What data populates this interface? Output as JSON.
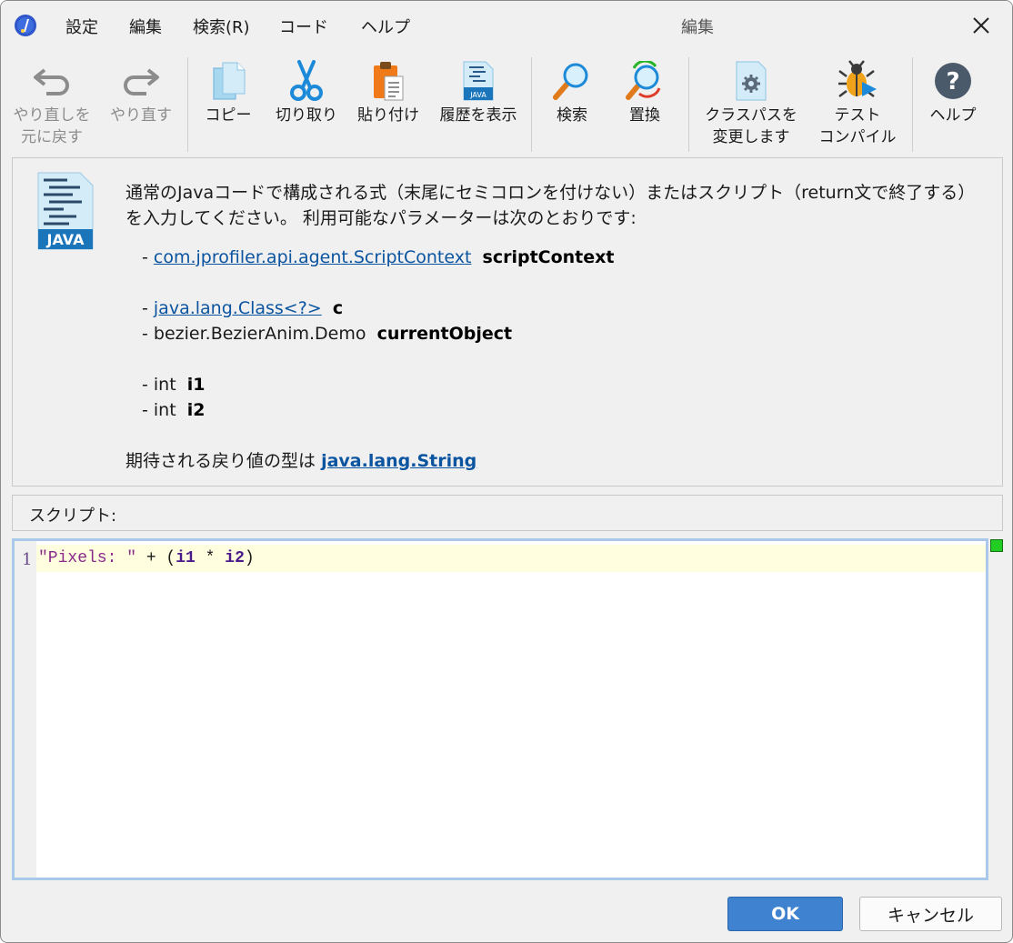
{
  "menu": {
    "settings": "設定",
    "edit": "編集",
    "search": "検索(R)",
    "code": "コード",
    "help": "ヘルプ"
  },
  "window_title": "編集",
  "toolbar": {
    "undo": "やり直しを\n元に戻す",
    "redo": "やり直す",
    "copy": "コピー",
    "cut": "切り取り",
    "paste": "貼り付け",
    "history": "履歴を表示",
    "find": "検索",
    "replace": "置換",
    "classpath": "クラスパスを\n変更します",
    "test_compile": "テスト\nコンパイル",
    "help": "ヘルプ"
  },
  "description": {
    "intro": "通常のJavaコードで構成される式（末尾にセミコロンを付けない）またはスクリプト（return文で終了する）を入力してください。 利用可能なパラメーターは次のとおりです:",
    "logo_text": "JAVA",
    "params": [
      {
        "prefix": "- ",
        "type": "com.jprofiler.api.agent.ScriptContext",
        "name": "scriptContext"
      },
      {
        "prefix": "- ",
        "type": "java.lang.Class<?>",
        "name": "c"
      },
      {
        "prefix": "- ",
        "type": "bezier.BezierAnim.Demo",
        "name": "currentObject"
      },
      {
        "prefix": "- ",
        "type": "int",
        "name": "i1"
      },
      {
        "prefix": "- ",
        "type": "int",
        "name": "i2"
      }
    ],
    "return_label": "期待される戻り値の型は",
    "return_type": "java.lang.String"
  },
  "script_label": "スクリプト:",
  "editor": {
    "line_number": "1",
    "code_string": "\"Pixels: \"",
    "code_op1": " + (",
    "code_var1": "i1",
    "code_op2": " * ",
    "code_var2": "i2",
    "code_close": ")"
  },
  "buttons": {
    "ok": "OK",
    "cancel": "キャンセル"
  }
}
